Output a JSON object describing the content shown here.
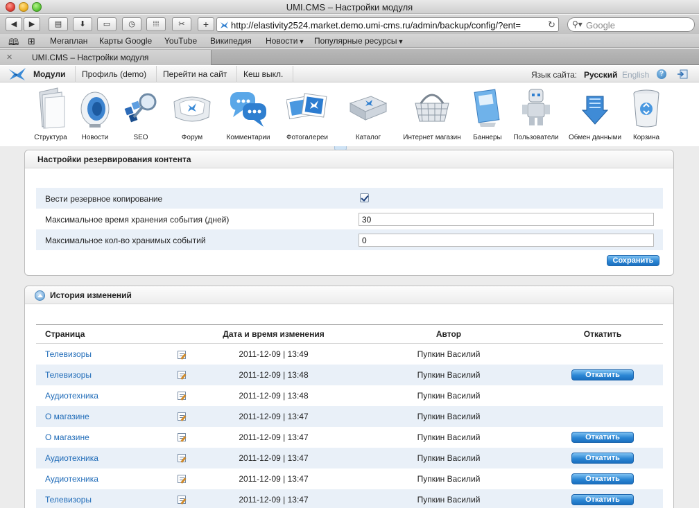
{
  "window": {
    "title": "UMI.CMS – Настройки модуля"
  },
  "toolbar": {
    "url": "http://elastivity2524.market.demo.umi-cms.ru/admin/backup/config/?ent=",
    "search_placeholder": "Google",
    "buttons": [
      {
        "id": "back",
        "glyph": "◀"
      },
      {
        "id": "forward",
        "glyph": "▶"
      },
      {
        "id": "print",
        "glyph": "▤"
      },
      {
        "id": "download",
        "glyph": "⬇"
      },
      {
        "id": "screen",
        "glyph": "▭"
      },
      {
        "id": "history",
        "glyph": "◷"
      },
      {
        "id": "grid",
        "glyph": "⁞⁞⁞"
      },
      {
        "id": "bookmark-tool",
        "glyph": "✂"
      },
      {
        "id": "add",
        "glyph": "+"
      }
    ]
  },
  "bookmarks": {
    "items": [
      {
        "label": "Мегаплан",
        "menu": false
      },
      {
        "label": "Карты Google",
        "menu": false
      },
      {
        "label": "YouTube",
        "menu": false
      },
      {
        "label": "Википедия",
        "menu": false
      },
      {
        "label": "Новости",
        "menu": true
      },
      {
        "label": "Популярные ресурсы",
        "menu": true
      }
    ]
  },
  "tab": {
    "label": "UMI.CMS – Настройки модуля",
    "close": "✕"
  },
  "umi": {
    "nav": [
      {
        "label": "Модули",
        "active": true
      },
      {
        "label": "Профиль (demo)",
        "active": false
      },
      {
        "label": "Перейти на сайт",
        "active": false
      },
      {
        "label": "Кеш выкл.",
        "active": false
      }
    ],
    "site_lang_label": "Язык сайта:",
    "lang_ru": "Русский",
    "lang_en": "English",
    "help": "?"
  },
  "modules": [
    {
      "label": "Структура",
      "icon": "folder-icon"
    },
    {
      "label": "Новости",
      "icon": "speaker-icon"
    },
    {
      "label": "SEO",
      "icon": "seo-icon"
    },
    {
      "label": "Форум",
      "icon": "forum-icon"
    },
    {
      "label": "Комментарии",
      "icon": "comments-icon"
    },
    {
      "label": "Фотогалереи",
      "icon": "photos-icon"
    },
    {
      "label": "Каталог",
      "icon": "catalog-icon"
    },
    {
      "label": "Интернет магазин",
      "icon": "basket-icon"
    },
    {
      "label": "Баннеры",
      "icon": "banners-icon"
    },
    {
      "label": "Пользователи",
      "icon": "users-icon"
    },
    {
      "label": "Обмен данными",
      "icon": "exchange-icon"
    },
    {
      "label": "Корзина",
      "icon": "trash-icon"
    }
  ],
  "backup_settings": {
    "title": "Настройки резервирования контента",
    "rows": [
      {
        "label": "Вести резервное копирование",
        "type": "checkbox",
        "checked": true
      },
      {
        "label": "Максимальное время хранения события (дней)",
        "type": "text",
        "value": "30"
      },
      {
        "label": "Максимальное кол-во хранимых событий",
        "type": "text",
        "value": "0"
      }
    ],
    "save_label": "Сохранить"
  },
  "history": {
    "title": "История изменений",
    "columns": {
      "page": "Страница",
      "date": "Дата и время изменения",
      "author": "Автор",
      "rollback": "Откатить"
    },
    "rollback_label": "Откатить",
    "rows": [
      {
        "page": "Телевизоры",
        "date": "2011-12-09 | 13:49",
        "author": "Пупкин Василий",
        "can_rollback": false
      },
      {
        "page": "Телевизоры",
        "date": "2011-12-09 | 13:48",
        "author": "Пупкин Василий",
        "can_rollback": true
      },
      {
        "page": "Аудиотехника",
        "date": "2011-12-09 | 13:48",
        "author": "Пупкин Василий",
        "can_rollback": false
      },
      {
        "page": "О магазине",
        "date": "2011-12-09 | 13:47",
        "author": "Пупкин Василий",
        "can_rollback": false
      },
      {
        "page": "О магазине",
        "date": "2011-12-09 | 13:47",
        "author": "Пупкин Василий",
        "can_rollback": true
      },
      {
        "page": "Аудиотехника",
        "date": "2011-12-09 | 13:47",
        "author": "Пупкин Василий",
        "can_rollback": true
      },
      {
        "page": "Аудиотехника",
        "date": "2011-12-09 | 13:47",
        "author": "Пупкин Василий",
        "can_rollback": true
      },
      {
        "page": "Телевизоры",
        "date": "2011-12-09 | 13:47",
        "author": "Пупкин Василий",
        "can_rollback": true
      }
    ]
  }
}
